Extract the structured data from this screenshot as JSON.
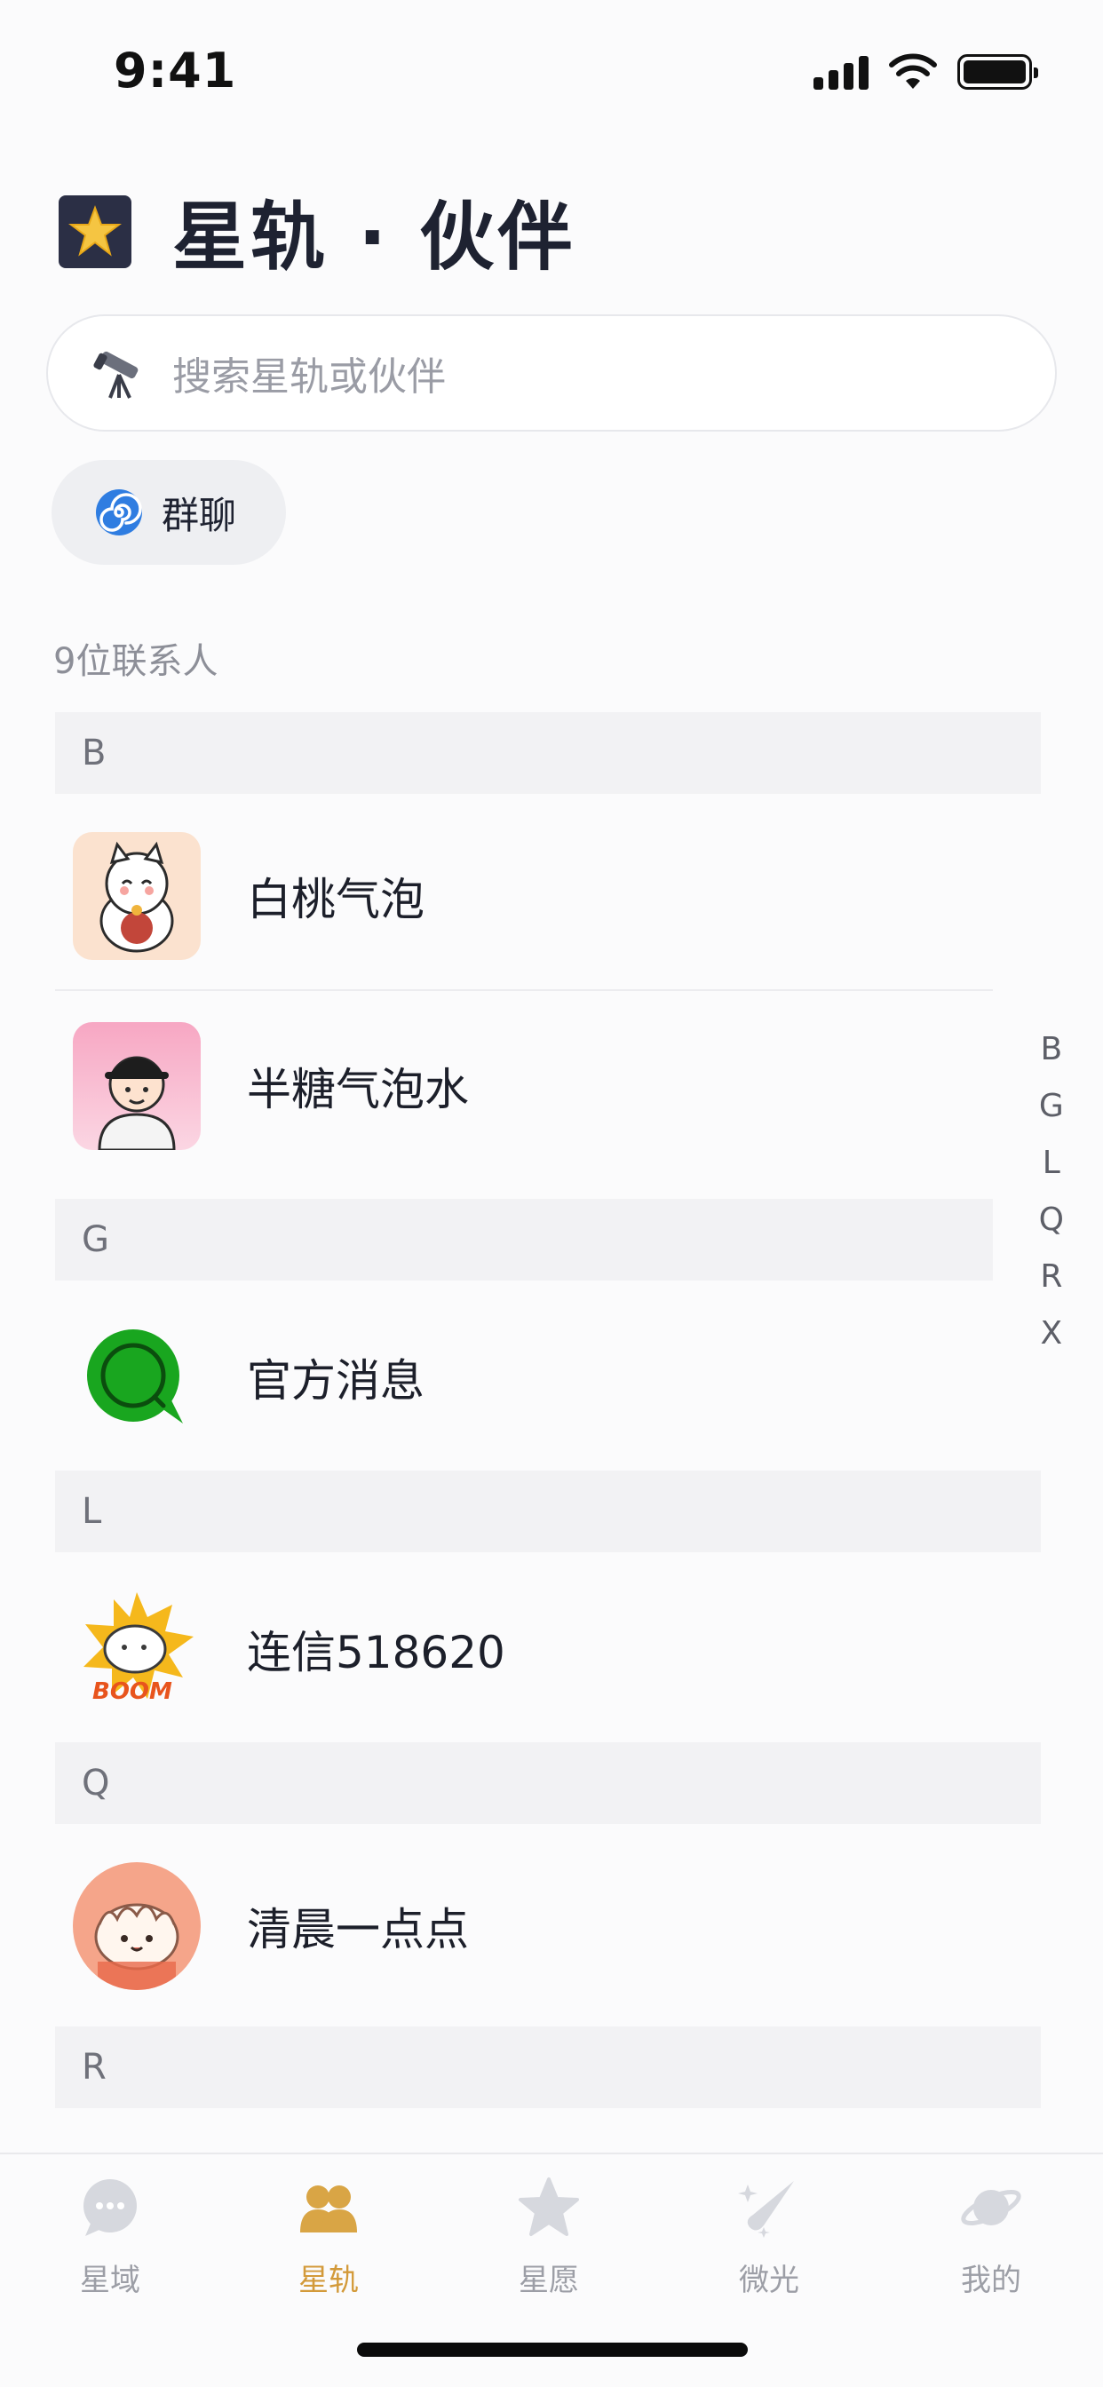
{
  "status_bar": {
    "time": "9:41"
  },
  "header": {
    "title": "星轨 · 伙伴",
    "icon": "star-icon"
  },
  "search": {
    "placeholder": "搜索星轨或伙伴",
    "icon": "telescope-icon"
  },
  "group_chip": {
    "label": "群聊",
    "icon": "spiral-icon"
  },
  "contact_count": "9位联系人",
  "sections": [
    {
      "letter": "B",
      "contacts": [
        {
          "name": "白桃气泡",
          "avatar": "lucky-cat-avatar"
        },
        {
          "name": "半糖气泡水",
          "avatar": "boy-cap-avatar"
        }
      ]
    },
    {
      "letter": "G",
      "contacts": [
        {
          "name": "官方消息",
          "avatar": "chat-bubble-avatar"
        }
      ]
    },
    {
      "letter": "L",
      "contacts": [
        {
          "name": "连信518620",
          "avatar": "boom-cat-avatar"
        }
      ]
    },
    {
      "letter": "Q",
      "contacts": [
        {
          "name": "清晨一点点",
          "avatar": "dumpling-avatar"
        }
      ]
    },
    {
      "letter": "R",
      "contacts": []
    }
  ],
  "index_letters": [
    "B",
    "G",
    "L",
    "Q",
    "R",
    "X"
  ],
  "tabs": [
    {
      "label": "星域",
      "icon": "chat-icon",
      "active": false
    },
    {
      "label": "星轨",
      "icon": "people-icon",
      "active": true
    },
    {
      "label": "星愿",
      "icon": "star-icon",
      "active": false
    },
    {
      "label": "微光",
      "icon": "comet-icon",
      "active": false
    },
    {
      "label": "我的",
      "icon": "planet-icon",
      "active": false
    }
  ],
  "colors": {
    "accent": "#d39a3a",
    "inactive": "#9c9ea6"
  }
}
